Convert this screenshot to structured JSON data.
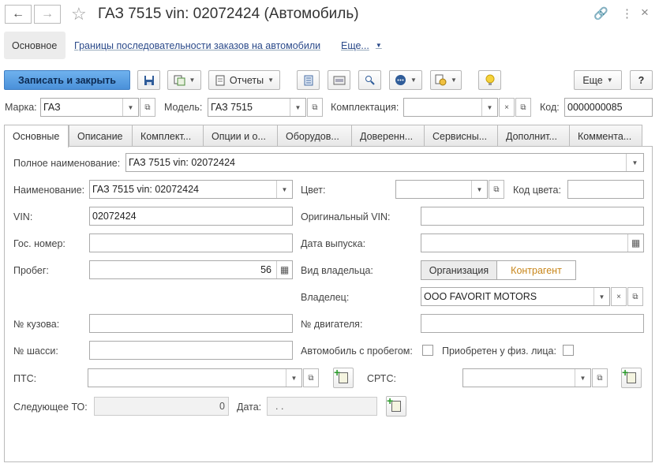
{
  "window": {
    "title": "ГАЗ 7515 vin: 02072424 (Автомобиль)"
  },
  "nav": {
    "main_tab": "Основное",
    "link1": "Границы последовательности заказов на автомобили",
    "more": "Еще..."
  },
  "toolbar": {
    "save_close": "Записать и закрыть",
    "reports": "Отчеты",
    "more": "Еще",
    "help": "?"
  },
  "top_fields": {
    "brand_label": "Марка:",
    "brand_value": "ГАЗ",
    "model_label": "Модель:",
    "model_value": "ГАЗ 7515",
    "config_label": "Комплектация:",
    "config_value": "",
    "code_label": "Код:",
    "code_value": "0000000085"
  },
  "tabs": [
    "Основные",
    "Описание",
    "Комплект...",
    "Опции и о...",
    "Оборудов...",
    "Доверенн...",
    "Сервисны...",
    "Дополнит...",
    "Коммента..."
  ],
  "form": {
    "full_name_label": "Полное наименование:",
    "full_name_value": "ГАЗ 7515 vin: 02072424",
    "name_label": "Наименование:",
    "name_value": "ГАЗ 7515 vin: 02072424",
    "color_label": "Цвет:",
    "color_value": "",
    "color_code_label": "Код цвета:",
    "color_code_value": "",
    "vin_label": "VIN:",
    "vin_value": "02072424",
    "orig_vin_label": "Оригинальный VIN:",
    "orig_vin_value": "",
    "plate_label": "Гос. номер:",
    "plate_value": "",
    "release_date_label": "Дата выпуска:",
    "release_date_value": "",
    "mileage_label": "Пробег:",
    "mileage_value": "56",
    "owner_type_label": "Вид владельца:",
    "owner_type_org": "Организация",
    "owner_type_counterparty": "Контрагент",
    "owner_label": "Владелец:",
    "owner_value": "ООО FAVORIT MOTORS",
    "body_no_label": "№ кузова:",
    "body_no_value": "",
    "engine_no_label": "№ двигателя:",
    "engine_no_value": "",
    "chassis_no_label": "№ шасси:",
    "chassis_no_value": "",
    "used_car_label": "Автомобиль с пробегом:",
    "bought_individual_label": "Приобретен у физ. лица:",
    "pts_label": "ПТС:",
    "pts_value": "",
    "srts_label": "СРТС:",
    "srts_value": "",
    "next_to_label": "Следующее ТО:",
    "next_to_value": "0",
    "date_label": "Дата:",
    "date_value": " .  ."
  },
  "colors": {
    "accent": "#4a90d9",
    "link": "#2b4a8a",
    "counterparty": "#c8861a"
  }
}
